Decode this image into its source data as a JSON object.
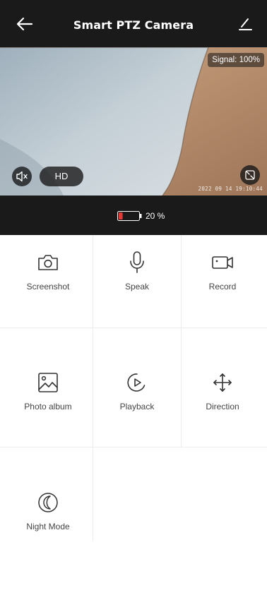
{
  "header": {
    "title": "Smart PTZ Camera",
    "back_icon": "arrow-left-icon",
    "edit_icon": "pencil-icon"
  },
  "video": {
    "signal": "Signal: 100%",
    "quality_label": "HD",
    "timestamp": "2022 09 14 19:10:44",
    "mute_icon": "speaker-muted-icon",
    "fullscreen_icon": "expand-icon"
  },
  "status": {
    "battery_text": "20 %",
    "battery_level": 0.2,
    "battery_color": "#e53935"
  },
  "actions": [
    {
      "label": "Screenshot",
      "icon": "camera-icon"
    },
    {
      "label": "Speak",
      "icon": "microphone-icon"
    },
    {
      "label": "Record",
      "icon": "video-camera-icon"
    },
    {
      "label": "Photo album",
      "icon": "image-icon"
    },
    {
      "label": "Playback",
      "icon": "playback-icon"
    },
    {
      "label": "Direction",
      "icon": "move-arrows-icon"
    },
    {
      "label": "Night Mode",
      "icon": "moon-icon"
    }
  ],
  "colors": {
    "header_bg": "#1a1a1a",
    "grid_divider": "#ececec",
    "label_text": "#444444"
  }
}
